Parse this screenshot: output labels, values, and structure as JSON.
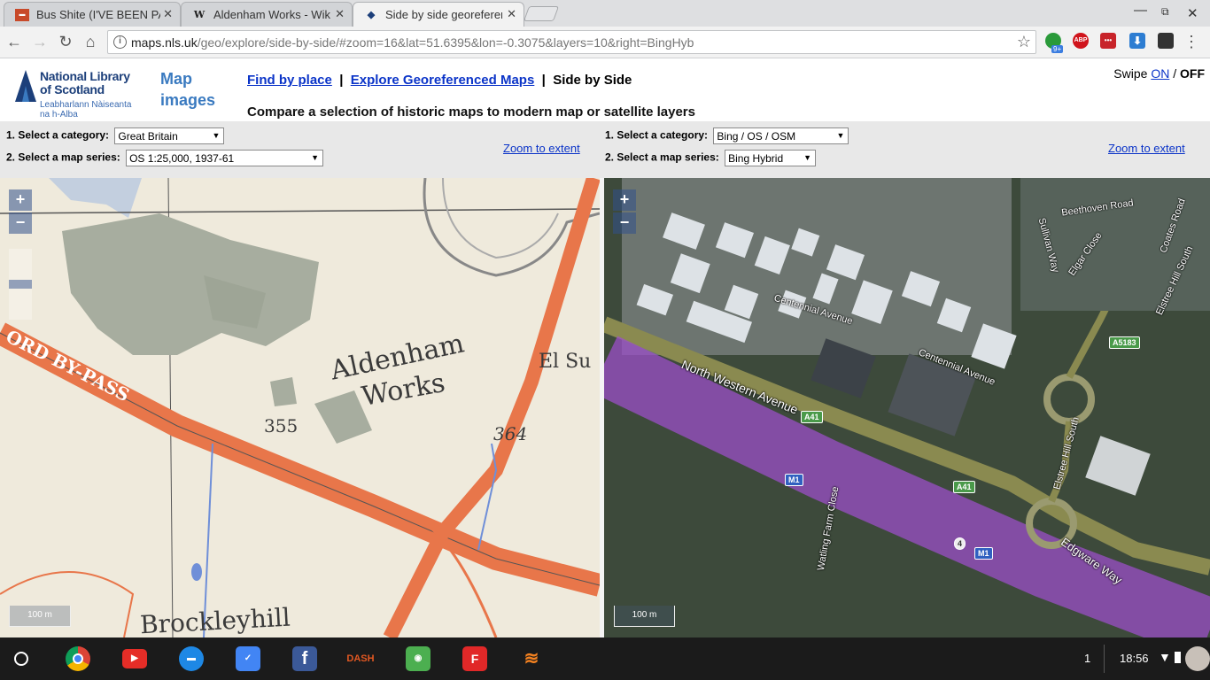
{
  "tabs": [
    {
      "title": "Bus Shite (I'VE BEEN PA",
      "favicon": "bus-favicon"
    },
    {
      "title": "Aldenham Works - Wikip",
      "favicon": "wikipedia-favicon"
    },
    {
      "title": "Side by side georeferenc",
      "favicon": "nls-favicon"
    }
  ],
  "address": {
    "host": "maps.nls.uk",
    "path": "/geo/explore/side-by-side/#zoom=16&lat=51.6395&lon=-0.3075&layers=10&right=BingHyb"
  },
  "extensions": {
    "badge": "9+",
    "abp": "ABP"
  },
  "header": {
    "logo_line1": "National Library",
    "logo_line2": "of Scotland",
    "logo_gaelic1": "Leabharlann Nàiseanta",
    "logo_gaelic2": "na h-Alba",
    "map_images_1": "Map",
    "map_images_2": "images",
    "link_find": "Find by place",
    "link_explore": "Explore Georeferenced Maps",
    "current_page": "Side by Side",
    "subtitle": "Compare a selection of historic maps to modern map or satellite layers",
    "swipe_label": "Swipe",
    "swipe_on": "ON",
    "swipe_off": "OFF"
  },
  "left_controls": {
    "category_label": "1. Select a category:",
    "category_value": "Great Britain",
    "series_label": "2. Select a map series:",
    "series_value": "OS 1:25,000, 1937-61",
    "zoom_extent": "Zoom to extent"
  },
  "right_controls": {
    "category_label": "1. Select a category:",
    "category_value": "Bing / OS / OSM",
    "series_label": "2. Select a map series:",
    "series_value": "Bing Hybrid",
    "zoom_extent": "Zoom to extent"
  },
  "left_map": {
    "labels": {
      "works1": "Aldenham",
      "works2": "Works",
      "bypass": "ORD BY-PASS",
      "h355": "355",
      "h364": "364",
      "elsu": "El Su",
      "brockley": "Brockleyhill"
    },
    "scale": "100 m"
  },
  "right_map": {
    "labels": {
      "beethoven": "Beethoven Road",
      "sullivan": "Sullivan Way",
      "elgar": "Elgar Close",
      "coates": "Coates Road",
      "elstree_south_top": "Elstree Hill South",
      "centennial1": "Centennial Avenue",
      "centennial2": "Centennial Avenue",
      "nwa": "North Western Avenue",
      "elstree_south_mid": "Elstree Hill South",
      "watling": "Watling Farm Close",
      "edgware": "Edgware Way"
    },
    "shields": {
      "a5183": "A5183",
      "a41a": "A41",
      "a41b": "A41",
      "m1a": "M1",
      "m1b": "M1",
      "j4": "4"
    },
    "scale": "100 m"
  },
  "zoom": {
    "plus": "+",
    "minus": "−"
  },
  "taskbar": {
    "apps": [
      "chrome-icon",
      "youtube-icon",
      "files-icon",
      "inbox-icon",
      "facebook-icon",
      "dash-icon",
      "toggle-app-icon",
      "flipboard-icon",
      "stack-icon"
    ],
    "dash_text": "DASH",
    "flip_text": "F",
    "notif_count": "1",
    "time": "18:56"
  },
  "colors": {
    "link": "#0b34c8",
    "mapimages": "#3a7ac0",
    "road": "#e8764a",
    "motorway": "#9b4fc8"
  }
}
